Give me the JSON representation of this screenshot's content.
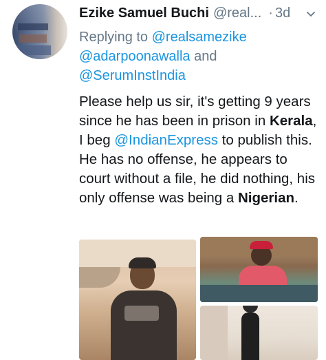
{
  "tweet": {
    "author_name": "Ezike Samuel Buchi",
    "author_handle": "@real...",
    "separator": "·",
    "time": "3d",
    "reply": {
      "prefix": "Replying to ",
      "mention_1": "@realsamezike",
      "mention_2": "@adarpoonawalla",
      "conjunction": " and",
      "mention_3": "@SerumInstIndia"
    },
    "body": {
      "part_1": "Please help us sir, it's getting 9 years since he has been in prison in ",
      "bold_1": "Kerala",
      "part_2": ", I beg ",
      "mention": "@IndianExpress",
      "part_3": " to publish this.  He has no offense, he appears to court without a file, he did nothing, his only offense was being a ",
      "bold_2": "Nigerian",
      "part_4": "."
    },
    "media": [
      {
        "name": "photo-1"
      },
      {
        "name": "photo-2"
      },
      {
        "name": "photo-3"
      }
    ]
  },
  "icons": {
    "menu": "chevron-down-icon"
  },
  "colors": {
    "link": "#1b95e0",
    "secondary_text": "#657786",
    "primary_text": "#14171a"
  }
}
